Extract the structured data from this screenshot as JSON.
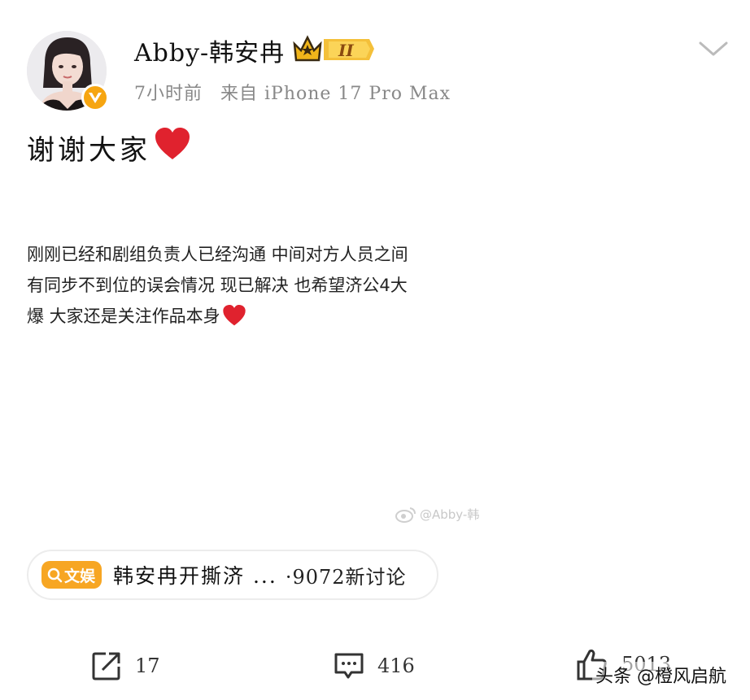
{
  "post": {
    "username": "Abby-韩安冉",
    "level": "II",
    "time": "7小时前",
    "source": "来自 iPhone 17 Pro Max",
    "headline": "谢谢大家",
    "body_lines": [
      "刚刚已经和剧组负责人已经沟通 中间对方人员之间",
      "有同步不到位的误会情况 现已解决 也希望济公4大",
      "爆 大家还是关注作品本身"
    ],
    "watermark": "@Abby-韩"
  },
  "topic": {
    "tag_label": "文娱",
    "title": "韩安冉开撕济 ...",
    "count": "·9072新讨论"
  },
  "actions": {
    "repost_count": "17",
    "comment_count": "416",
    "like_count": "5013"
  },
  "footer": {
    "watermark": "头条 @橙风启航"
  },
  "colors": {
    "accent": "#f7a623",
    "vbadge": "#f6a511",
    "heart": "#e0222e"
  }
}
